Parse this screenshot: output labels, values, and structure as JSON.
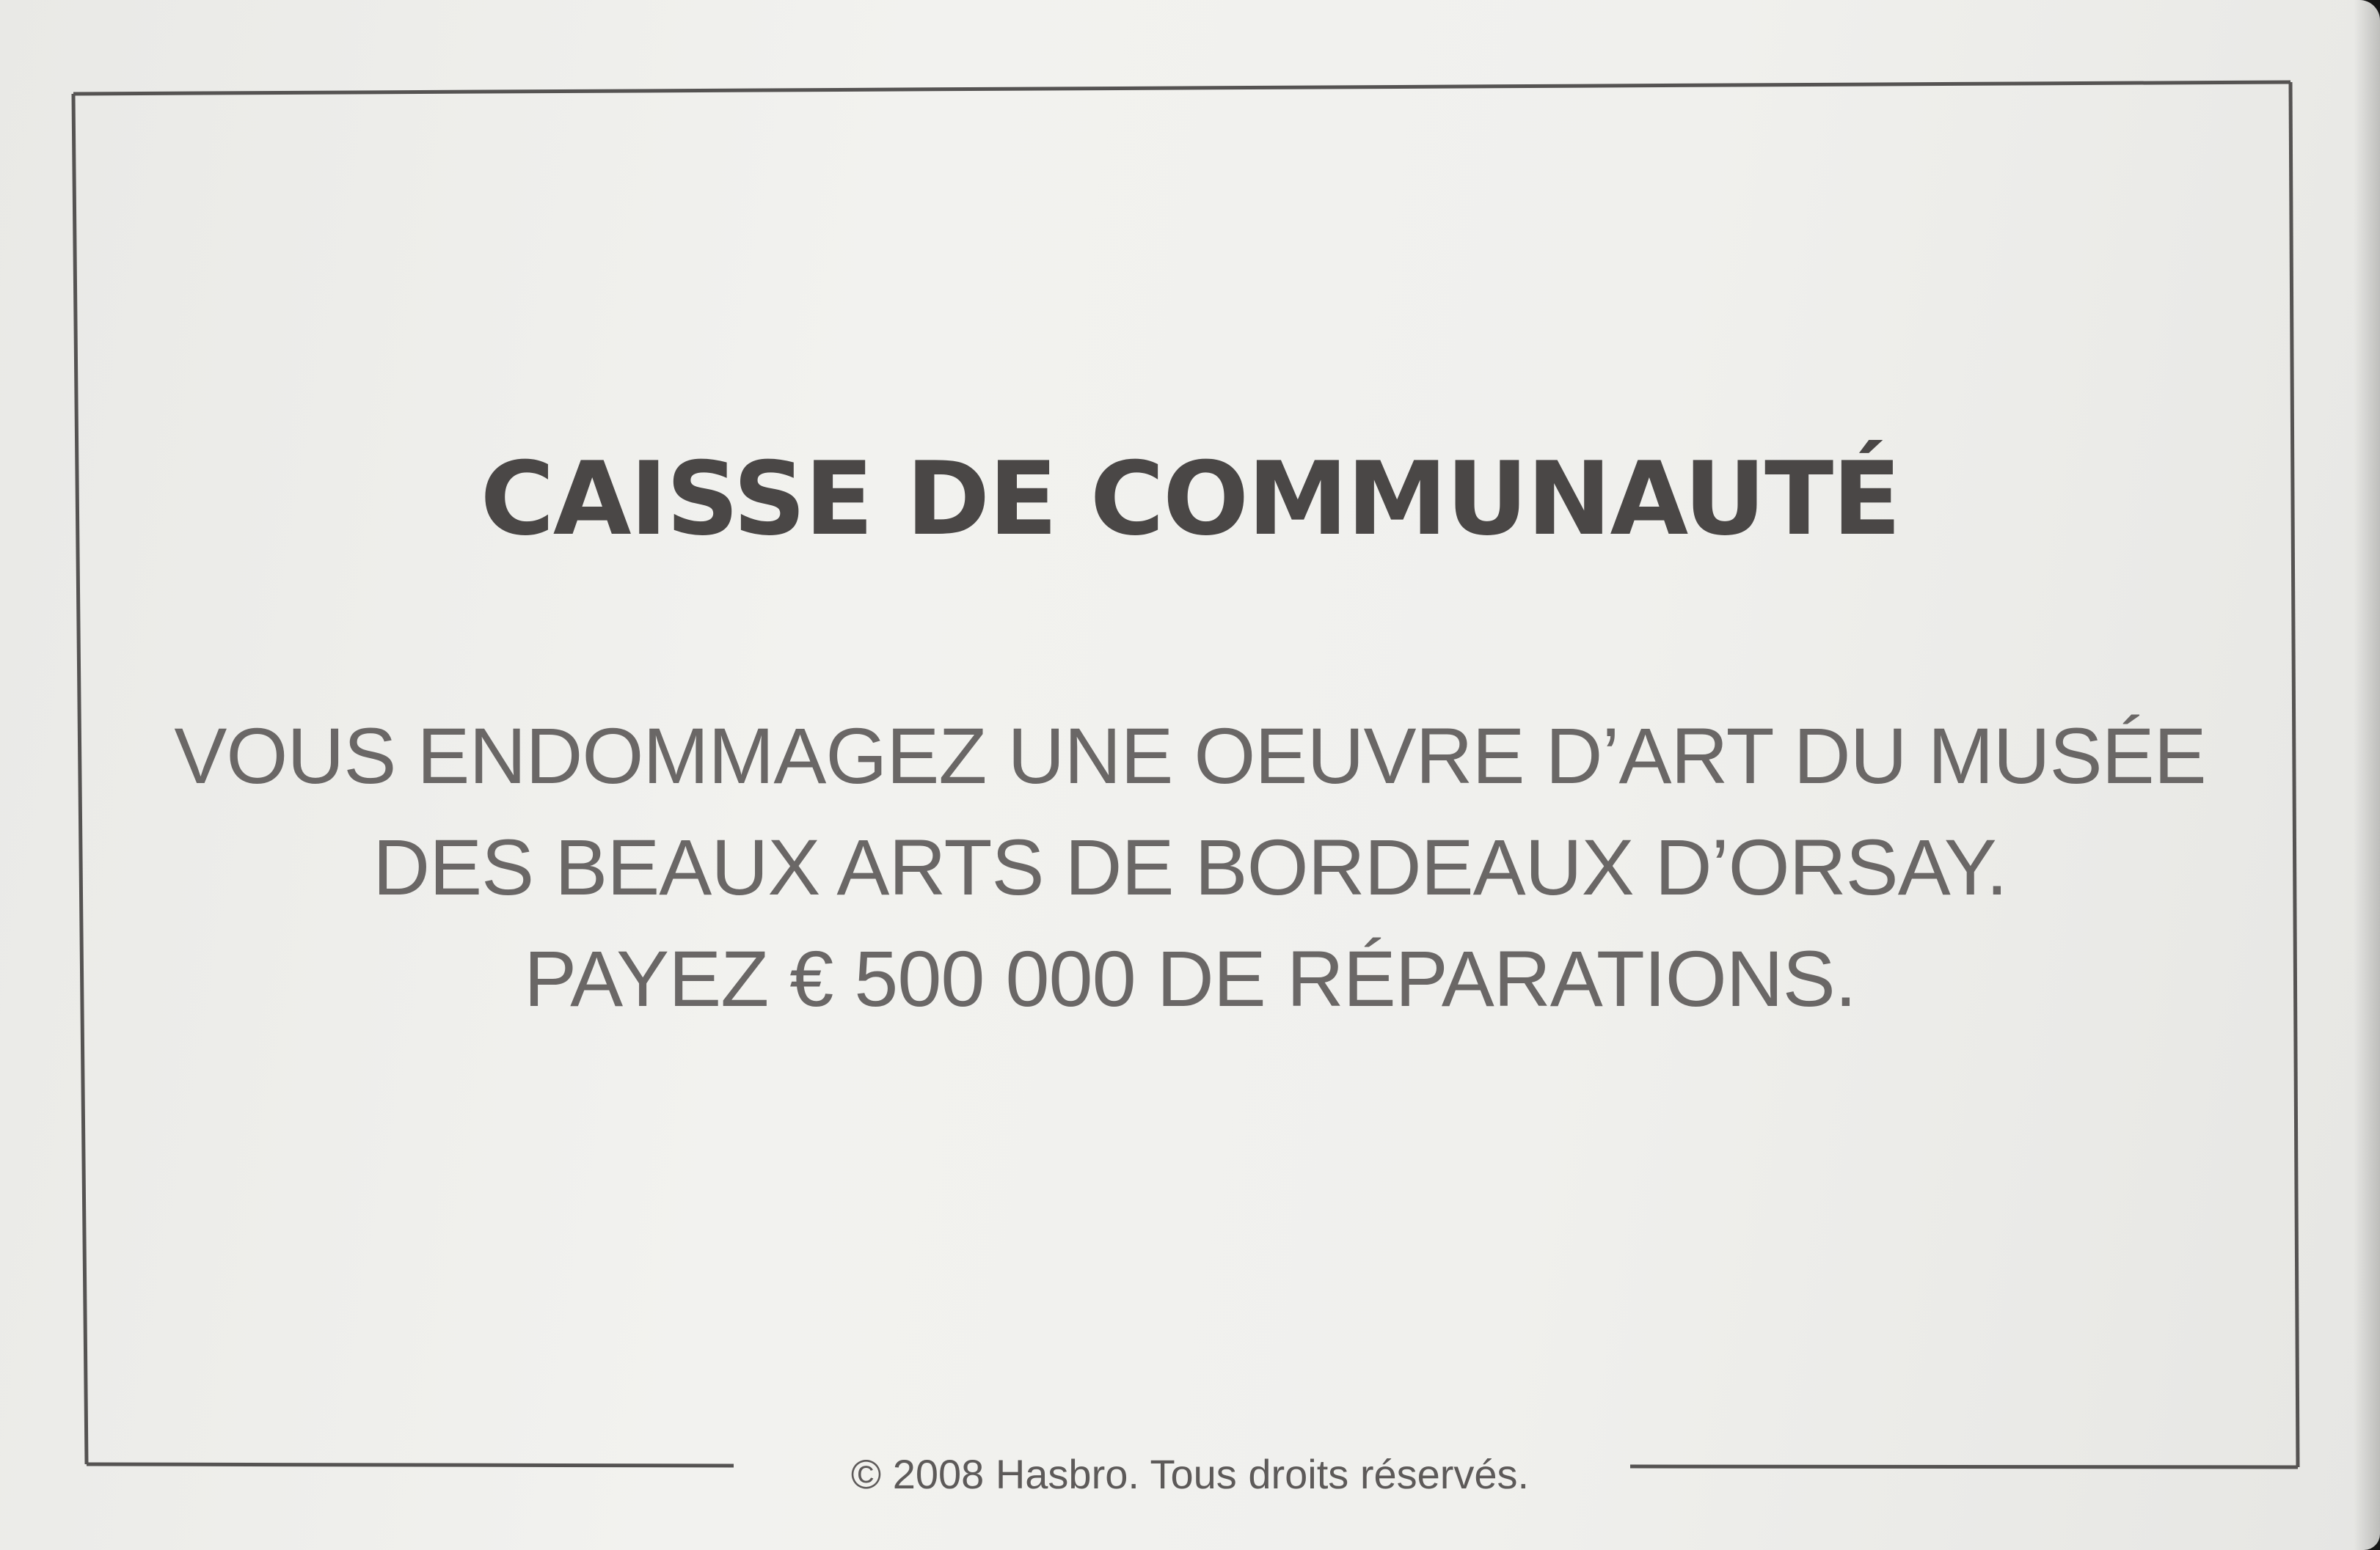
{
  "card": {
    "title": "CAISSE DE COMMUNAUTÉ",
    "body_lines": [
      "VOUS ENDOMMAGEZ UNE OEUVRE D’ART DU MUSÉE",
      "DES BEAUX ARTS DE BORDEAUX D’ORSAY.",
      "PAYEZ € 500 000 DE RÉPARATIONS."
    ],
    "copyright": "© 2008 Hasbro. Tous droits réservés."
  },
  "colors": {
    "card_background": "#ededeb",
    "frame_line": "#555352",
    "title_text": "#4a4746",
    "body_text": "#6a6766",
    "backdrop": "#161616"
  }
}
